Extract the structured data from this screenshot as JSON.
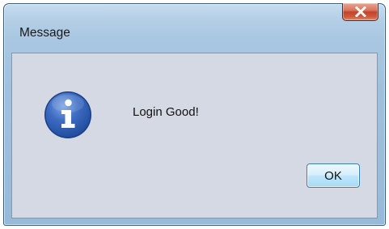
{
  "window": {
    "title": "Message"
  },
  "dialog": {
    "icon": "info-icon",
    "message": "Login Good!",
    "ok_label": "OK"
  },
  "colors": {
    "icon_blue": "#2d5fb5",
    "close_red": "#c1432a",
    "dialog_bg": "#d5d9e3"
  }
}
